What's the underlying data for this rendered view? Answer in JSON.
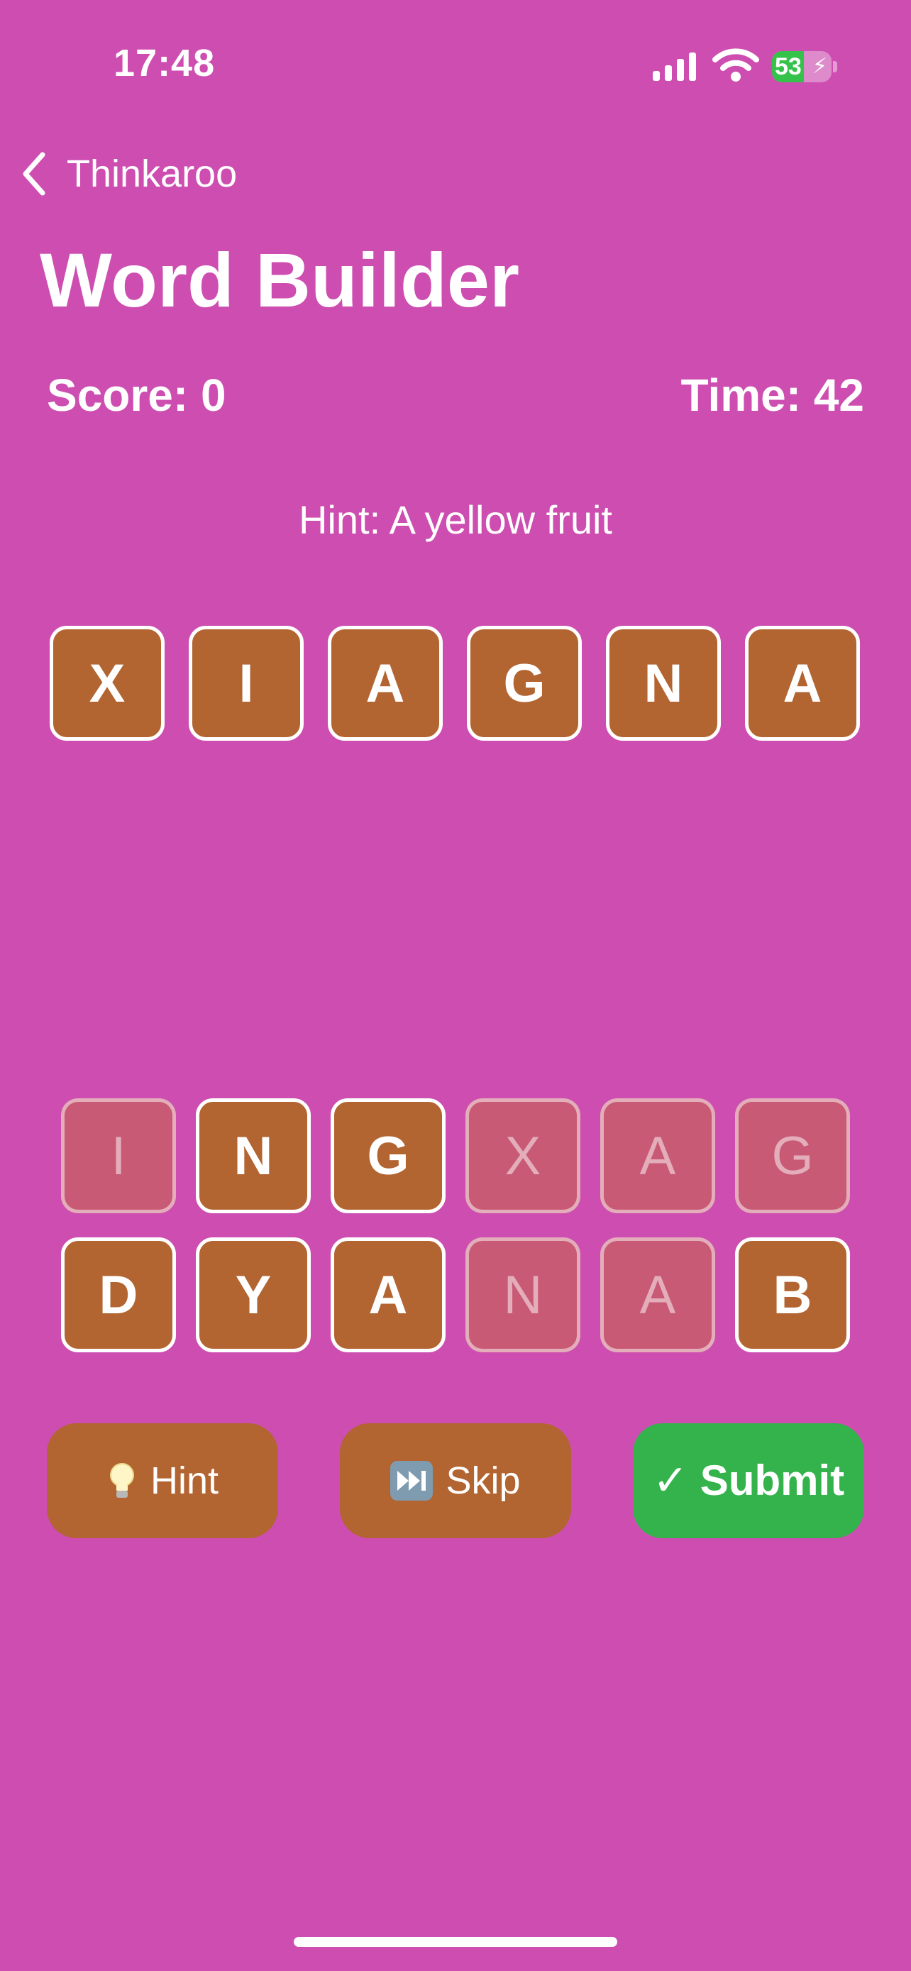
{
  "status_bar": {
    "time": "17:48",
    "battery_level": "53",
    "battery_fill": 0.53,
    "battery_color": "#35c24a",
    "icons": [
      "cellular-signal-icon",
      "wifi-icon",
      "battery-charging-icon"
    ]
  },
  "nav": {
    "back_label": "Thinkaroo",
    "back_icon": "chevron-left-icon"
  },
  "page": {
    "title": "Word Builder"
  },
  "stats": {
    "score": "Score: 0",
    "time": "Time: 42"
  },
  "hint": {
    "text": "Hint: A yellow fruit"
  },
  "answer_tiles": [
    "X",
    "I",
    "A",
    "G",
    "N",
    "A"
  ],
  "letter_bank": {
    "row1": [
      {
        "letter": "I",
        "used": true
      },
      {
        "letter": "N",
        "used": false
      },
      {
        "letter": "G",
        "used": false
      },
      {
        "letter": "X",
        "used": true
      },
      {
        "letter": "A",
        "used": true
      },
      {
        "letter": "G",
        "used": true
      }
    ],
    "row2": [
      {
        "letter": "D",
        "used": false
      },
      {
        "letter": "Y",
        "used": false
      },
      {
        "letter": "A",
        "used": false
      },
      {
        "letter": "N",
        "used": true
      },
      {
        "letter": "A",
        "used": true
      },
      {
        "letter": "B",
        "used": false
      }
    ]
  },
  "actions": {
    "hint_label": "Hint",
    "hint_icon": "lightbulb-icon",
    "skip_label": "Skip",
    "skip_icon": "fast-forward-icon",
    "submit_label": "✓ Submit"
  },
  "colors": {
    "background": "#cd4eb0",
    "tile": "#b26431",
    "tile_used": "#c85a75",
    "submit": "#34b34d"
  }
}
